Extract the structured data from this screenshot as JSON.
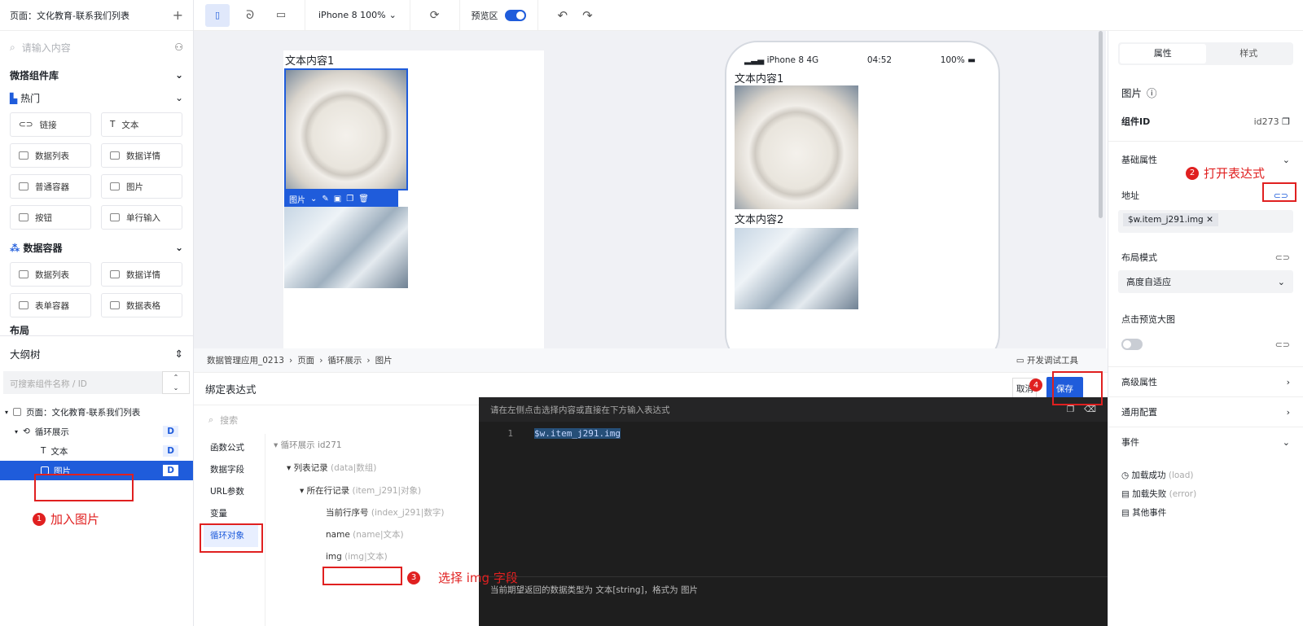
{
  "left": {
    "page_title": "页面：文化教育-联系我们列表",
    "search_placeholder": "请输入内容",
    "library": "微搭组件库",
    "hot": "热门",
    "hot_items": [
      "链接",
      "文本",
      "数据列表",
      "数据详情",
      "普通容器",
      "图片",
      "按钮",
      "单行输入"
    ],
    "data_container": "数据容器",
    "data_items": [
      "数据列表",
      "数据详情",
      "表单容器",
      "数据表格"
    ],
    "layout": "布局",
    "outline": "大纲树",
    "outline_search": "可搜索组件名称 / ID",
    "tree": {
      "page": "页面：文化教育-联系我们列表",
      "loop": "循环展示",
      "text": "文本",
      "image": "图片",
      "badge": "D"
    },
    "annot1": "加入图片"
  },
  "toolbar": {
    "device": "iPhone 8 100%",
    "preview": "预览区"
  },
  "canvas": {
    "text1": "文本内容1",
    "image_label": "图片",
    "phone_status": {
      "carrier": "iPhone 8  4G",
      "time": "04:52",
      "battery": "100%"
    },
    "phone_text1": "文本内容1",
    "phone_text2": "文本内容2"
  },
  "right": {
    "tab_props": "属性",
    "tab_style": "样式",
    "title": "图片",
    "id_label": "组件ID",
    "id_value": "id273",
    "basic": "基础属性",
    "address": "地址",
    "address_value": "$w.item_j291.img",
    "layout_mode": "布局模式",
    "layout_value": "高度自适应",
    "click_preview": "点击预览大图",
    "advanced": "高级属性",
    "common": "通用配置",
    "events": "事件",
    "event_list": [
      {
        "name": "加载成功",
        "code": "(load)"
      },
      {
        "name": "加载失败",
        "code": "(error)"
      },
      {
        "name": "其他事件",
        "code": ""
      }
    ],
    "annot2": "打开表达式"
  },
  "bottom": {
    "breadcrumb": [
      "数据管理应用_0213",
      "页面",
      "循环展示",
      "图片"
    ],
    "dev_tools": "开发调试工具",
    "title": "绑定表达式",
    "cancel": "取消",
    "save": "保存",
    "search": "搜索",
    "cats": [
      "函数公式",
      "数据字段",
      "URL参数",
      "变量",
      "循环对象"
    ],
    "tree_root": "循环展示 id271",
    "tree_list": "列表记录",
    "tree_list_t": "(data|数组)",
    "tree_row": "所在行记录",
    "tree_row_t": "(item_j291|对象)",
    "fields": [
      {
        "name": "当前行序号",
        "t": "(index_j291|数字)"
      },
      {
        "name": "name",
        "t": "(name|文本)"
      },
      {
        "name": "img",
        "t": "(img|文本)"
      }
    ],
    "annot3": "选择 img 字段",
    "editor_hint": "请在左侧点击选择内容或直接在下方输入表达式",
    "line_no": "1",
    "code": "$w.item_j291.img",
    "footer": "当前期望返回的数据类型为 文本[string]，格式为 图片"
  },
  "annot_nums": [
    "1",
    "2",
    "3",
    "4"
  ]
}
